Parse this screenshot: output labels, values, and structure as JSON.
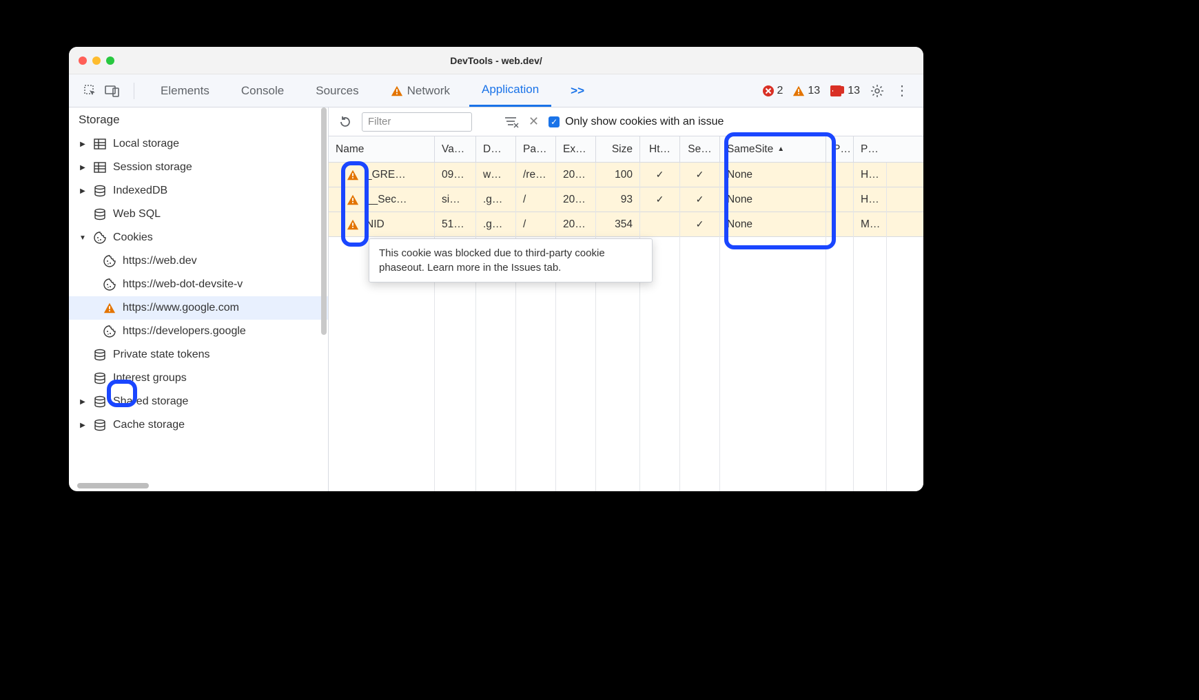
{
  "window": {
    "title": "DevTools - web.dev/"
  },
  "tabs": {
    "elements": "Elements",
    "console": "Console",
    "sources": "Sources",
    "network": "Network",
    "application": "Application",
    "overflow": ">>"
  },
  "status": {
    "errors": "2",
    "warnings": "13",
    "issues": "13"
  },
  "sidebar": {
    "heading": "Storage",
    "items": [
      {
        "label": "Local storage",
        "icon": "db-grid",
        "expandable": true,
        "expanded": false,
        "level": 1
      },
      {
        "label": "Session storage",
        "icon": "db-grid",
        "expandable": true,
        "expanded": false,
        "level": 1
      },
      {
        "label": "IndexedDB",
        "icon": "db-barrel",
        "expandable": true,
        "expanded": false,
        "level": 1
      },
      {
        "label": "Web SQL",
        "icon": "db-barrel",
        "expandable": false,
        "expanded": false,
        "level": 1
      },
      {
        "label": "Cookies",
        "icon": "cookie",
        "expandable": true,
        "expanded": true,
        "level": 1
      },
      {
        "label": "https://web.dev",
        "icon": "cookie",
        "level": 2
      },
      {
        "label": "https://web-dot-devsite-v",
        "icon": "cookie",
        "level": 2
      },
      {
        "label": "https://www.google.com",
        "icon": "warning",
        "selected": true,
        "level": 2
      },
      {
        "label": "https://developers.google",
        "icon": "cookie",
        "level": 2
      },
      {
        "label": "Private state tokens",
        "icon": "db-barrel",
        "expandable": false,
        "level": 1
      },
      {
        "label": "Interest groups",
        "icon": "db-barrel",
        "expandable": false,
        "level": 1
      },
      {
        "label": "Shared storage",
        "icon": "db-barrel",
        "expandable": true,
        "expanded": false,
        "level": 1
      },
      {
        "label": "Cache storage",
        "icon": "db-barrel",
        "expandable": true,
        "expanded": false,
        "level": 1
      }
    ]
  },
  "filter": {
    "placeholder": "Filter",
    "checkbox_label": "Only show cookies with an issue"
  },
  "columns": {
    "name": "Name",
    "value": "Va…",
    "domain": "D…",
    "path": "Pa…",
    "expires": "Ex…",
    "size": "Size",
    "http": "Ht…",
    "secure": "Se…",
    "samesite": "SameSite",
    "pa": "P…",
    "priority": "P…"
  },
  "rows": [
    {
      "name": "_GRE…",
      "value": "09…",
      "domain": "w…",
      "path": "/re…",
      "expires": "20…",
      "size": "100",
      "http": "✓",
      "secure": "✓",
      "samesite": "None",
      "pa": "",
      "priority": "H…"
    },
    {
      "name": "__Sec…",
      "value": "si…",
      "domain": ".g…",
      "path": "/",
      "expires": "20…",
      "size": "93",
      "http": "✓",
      "secure": "✓",
      "samesite": "None",
      "pa": "",
      "priority": "H…"
    },
    {
      "name": "NID",
      "value": "51…",
      "domain": ".g…",
      "path": "/",
      "expires": "20…",
      "size": "354",
      "http": "",
      "secure": "✓",
      "samesite": "None",
      "pa": "",
      "priority": "M…"
    }
  ],
  "tooltip": {
    "text": "This cookie was blocked due to third-party cookie phaseout. Learn more in the Issues tab."
  }
}
